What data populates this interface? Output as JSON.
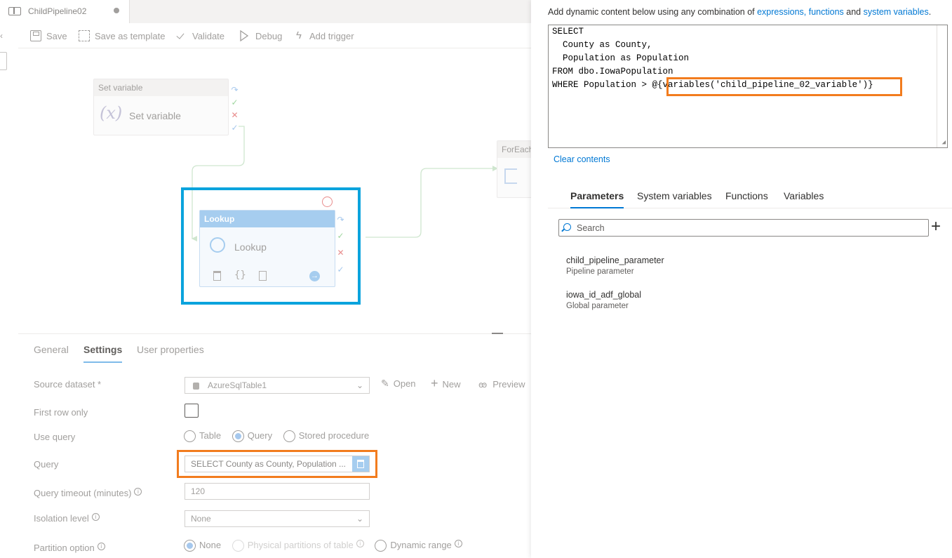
{
  "tab": {
    "title": "ChildPipeline02"
  },
  "toolbar": {
    "save": "Save",
    "save_template": "Save as template",
    "validate": "Validate",
    "debug": "Debug",
    "add_trigger": "Add trigger"
  },
  "canvas": {
    "set_variable": {
      "header": "Set variable",
      "label": "Set variable",
      "icon_text": "(x)"
    },
    "foreach": {
      "header": "ForEach"
    },
    "lookup": {
      "header": "Lookup",
      "label": "Lookup",
      "braces": "{}"
    }
  },
  "settings": {
    "tabs": [
      "General",
      "Settings",
      "User properties"
    ],
    "source_dataset": {
      "label": "Source dataset *",
      "value": "AzureSqlTable1",
      "open": "Open",
      "new": "New",
      "preview": "Preview"
    },
    "first_row_only": {
      "label": "First row only"
    },
    "use_query": {
      "label": "Use query",
      "options": [
        "Table",
        "Query",
        "Stored procedure"
      ]
    },
    "query": {
      "label": "Query",
      "value": "SELECT County as County, Population ..."
    },
    "timeout": {
      "label": "Query timeout (minutes)",
      "value": "120"
    },
    "isolation": {
      "label": "Isolation level",
      "value": "None"
    },
    "partition": {
      "label": "Partition option",
      "options": [
        "None",
        "Physical partitions of table",
        "Dynamic range"
      ]
    }
  },
  "expression_panel": {
    "hint_prefix": "Add dynamic content below using any combination of ",
    "hint_link1": "expressions, functions",
    "hint_and": " and ",
    "hint_link2": "system variables",
    "hint_suffix": ".",
    "lines": [
      "SELECT",
      "  County as County,",
      "  Population as Population",
      "FROM dbo.IowaPopulation",
      "WHERE Population > @{variables('child_pipeline_02_variable')}"
    ],
    "clear": "Clear contents",
    "tabs": [
      "Parameters",
      "System variables",
      "Functions",
      "Variables"
    ],
    "search_placeholder": "Search",
    "params": [
      {
        "name": "child_pipeline_parameter",
        "type": "Pipeline parameter"
      },
      {
        "name": "iowa_id_adf_global",
        "type": "Global parameter"
      }
    ]
  }
}
